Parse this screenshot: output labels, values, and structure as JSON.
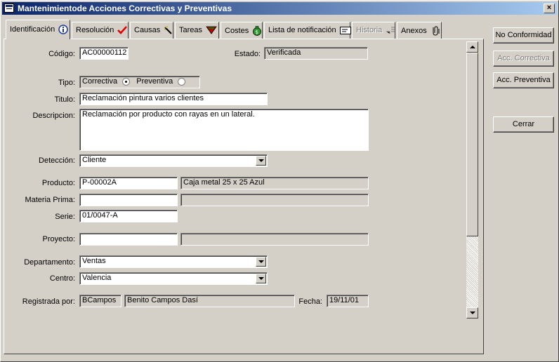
{
  "window": {
    "title": "Mantenimientode Acciones Correctivas y Preventivas",
    "close_glyph": "×"
  },
  "tabs": [
    {
      "label": "Identificación",
      "icon": "info-icon"
    },
    {
      "label": "Resolución",
      "icon": "checkmark-icon"
    },
    {
      "label": "Causas",
      "icon": "wand-icon"
    },
    {
      "label": "Tareas",
      "icon": "tasks-icon"
    },
    {
      "label": "Costes",
      "icon": "money-bag-icon"
    },
    {
      "label": "Lista de notificación",
      "icon": "envelope-icon"
    },
    {
      "label": "Historia",
      "icon": "history-icon"
    },
    {
      "label": "Anexos",
      "icon": "paperclip-icon"
    }
  ],
  "form": {
    "codigo": {
      "label": "Código:",
      "value": "AC00000112"
    },
    "estado": {
      "label": "Estado:",
      "value": "Verificada"
    },
    "tipo": {
      "label": "Tipo:",
      "option1": "Correctiva",
      "option2": "Preventiva",
      "selected": "Correctiva"
    },
    "titulo": {
      "label": "Titulo:",
      "value": "Reclamación pintura varios clientes"
    },
    "descripcion": {
      "label": "Descripcion:",
      "value": "Reclamación por producto con rayas en un lateral."
    },
    "deteccion": {
      "label": "Detección:",
      "value": "Cliente"
    },
    "producto": {
      "label": "Producto:",
      "code": "P-00002A",
      "description": "Caja metal 25 x 25 Azul"
    },
    "materia_prima": {
      "label": "Materia Prima:",
      "code": "",
      "description": ""
    },
    "serie": {
      "label": "Serie:",
      "value": "01/0047-A"
    },
    "proyecto": {
      "label": "Proyecto:",
      "code": "",
      "description": ""
    },
    "departamento": {
      "label": "Departamento:",
      "value": "Ventas"
    },
    "centro": {
      "label": "Centro:",
      "value": "Valencia"
    },
    "registrada": {
      "label": "Registrada por:",
      "user": "BCampos",
      "name": "Benito Campos Dasí"
    },
    "fecha": {
      "label": "Fecha:",
      "value": "19/11/01"
    }
  },
  "buttons": {
    "no_conformidad": "No Conformidad",
    "acc_correctiva": "Acc. Correctiva",
    "acc_preventiva": "Acc. Preventiva",
    "cerrar": "Cerrar"
  },
  "colors": {
    "titlebar_start": "#0a246a",
    "titlebar_end": "#a6caf0",
    "face": "#d4d0c8"
  }
}
